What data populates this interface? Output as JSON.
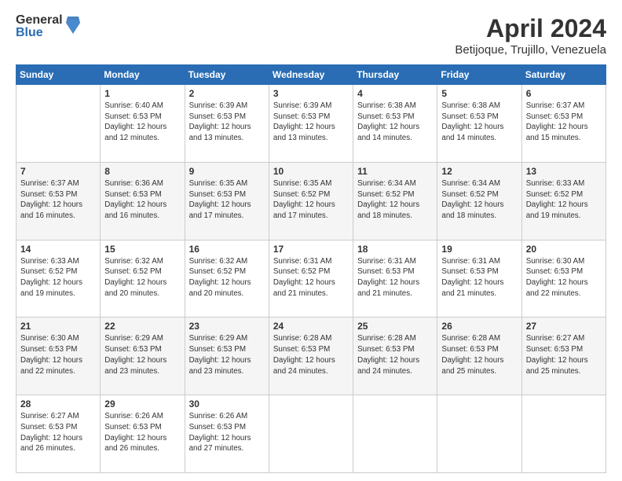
{
  "logo": {
    "general": "General",
    "blue": "Blue"
  },
  "title": "April 2024",
  "location": "Betijoque, Trujillo, Venezuela",
  "days_header": [
    "Sunday",
    "Monday",
    "Tuesday",
    "Wednesday",
    "Thursday",
    "Friday",
    "Saturday"
  ],
  "weeks": [
    [
      {
        "day": "",
        "info": ""
      },
      {
        "day": "1",
        "info": "Sunrise: 6:40 AM\nSunset: 6:53 PM\nDaylight: 12 hours\nand 12 minutes."
      },
      {
        "day": "2",
        "info": "Sunrise: 6:39 AM\nSunset: 6:53 PM\nDaylight: 12 hours\nand 13 minutes."
      },
      {
        "day": "3",
        "info": "Sunrise: 6:39 AM\nSunset: 6:53 PM\nDaylight: 12 hours\nand 13 minutes."
      },
      {
        "day": "4",
        "info": "Sunrise: 6:38 AM\nSunset: 6:53 PM\nDaylight: 12 hours\nand 14 minutes."
      },
      {
        "day": "5",
        "info": "Sunrise: 6:38 AM\nSunset: 6:53 PM\nDaylight: 12 hours\nand 14 minutes."
      },
      {
        "day": "6",
        "info": "Sunrise: 6:37 AM\nSunset: 6:53 PM\nDaylight: 12 hours\nand 15 minutes."
      }
    ],
    [
      {
        "day": "7",
        "info": "Sunrise: 6:37 AM\nSunset: 6:53 PM\nDaylight: 12 hours\nand 16 minutes."
      },
      {
        "day": "8",
        "info": "Sunrise: 6:36 AM\nSunset: 6:53 PM\nDaylight: 12 hours\nand 16 minutes."
      },
      {
        "day": "9",
        "info": "Sunrise: 6:35 AM\nSunset: 6:53 PM\nDaylight: 12 hours\nand 17 minutes."
      },
      {
        "day": "10",
        "info": "Sunrise: 6:35 AM\nSunset: 6:52 PM\nDaylight: 12 hours\nand 17 minutes."
      },
      {
        "day": "11",
        "info": "Sunrise: 6:34 AM\nSunset: 6:52 PM\nDaylight: 12 hours\nand 18 minutes."
      },
      {
        "day": "12",
        "info": "Sunrise: 6:34 AM\nSunset: 6:52 PM\nDaylight: 12 hours\nand 18 minutes."
      },
      {
        "day": "13",
        "info": "Sunrise: 6:33 AM\nSunset: 6:52 PM\nDaylight: 12 hours\nand 19 minutes."
      }
    ],
    [
      {
        "day": "14",
        "info": "Sunrise: 6:33 AM\nSunset: 6:52 PM\nDaylight: 12 hours\nand 19 minutes."
      },
      {
        "day": "15",
        "info": "Sunrise: 6:32 AM\nSunset: 6:52 PM\nDaylight: 12 hours\nand 20 minutes."
      },
      {
        "day": "16",
        "info": "Sunrise: 6:32 AM\nSunset: 6:52 PM\nDaylight: 12 hours\nand 20 minutes."
      },
      {
        "day": "17",
        "info": "Sunrise: 6:31 AM\nSunset: 6:52 PM\nDaylight: 12 hours\nand 21 minutes."
      },
      {
        "day": "18",
        "info": "Sunrise: 6:31 AM\nSunset: 6:53 PM\nDaylight: 12 hours\nand 21 minutes."
      },
      {
        "day": "19",
        "info": "Sunrise: 6:31 AM\nSunset: 6:53 PM\nDaylight: 12 hours\nand 21 minutes."
      },
      {
        "day": "20",
        "info": "Sunrise: 6:30 AM\nSunset: 6:53 PM\nDaylight: 12 hours\nand 22 minutes."
      }
    ],
    [
      {
        "day": "21",
        "info": "Sunrise: 6:30 AM\nSunset: 6:53 PM\nDaylight: 12 hours\nand 22 minutes."
      },
      {
        "day": "22",
        "info": "Sunrise: 6:29 AM\nSunset: 6:53 PM\nDaylight: 12 hours\nand 23 minutes."
      },
      {
        "day": "23",
        "info": "Sunrise: 6:29 AM\nSunset: 6:53 PM\nDaylight: 12 hours\nand 23 minutes."
      },
      {
        "day": "24",
        "info": "Sunrise: 6:28 AM\nSunset: 6:53 PM\nDaylight: 12 hours\nand 24 minutes."
      },
      {
        "day": "25",
        "info": "Sunrise: 6:28 AM\nSunset: 6:53 PM\nDaylight: 12 hours\nand 24 minutes."
      },
      {
        "day": "26",
        "info": "Sunrise: 6:28 AM\nSunset: 6:53 PM\nDaylight: 12 hours\nand 25 minutes."
      },
      {
        "day": "27",
        "info": "Sunrise: 6:27 AM\nSunset: 6:53 PM\nDaylight: 12 hours\nand 25 minutes."
      }
    ],
    [
      {
        "day": "28",
        "info": "Sunrise: 6:27 AM\nSunset: 6:53 PM\nDaylight: 12 hours\nand 26 minutes."
      },
      {
        "day": "29",
        "info": "Sunrise: 6:26 AM\nSunset: 6:53 PM\nDaylight: 12 hours\nand 26 minutes."
      },
      {
        "day": "30",
        "info": "Sunrise: 6:26 AM\nSunset: 6:53 PM\nDaylight: 12 hours\nand 27 minutes."
      },
      {
        "day": "",
        "info": ""
      },
      {
        "day": "",
        "info": ""
      },
      {
        "day": "",
        "info": ""
      },
      {
        "day": "",
        "info": ""
      }
    ]
  ]
}
